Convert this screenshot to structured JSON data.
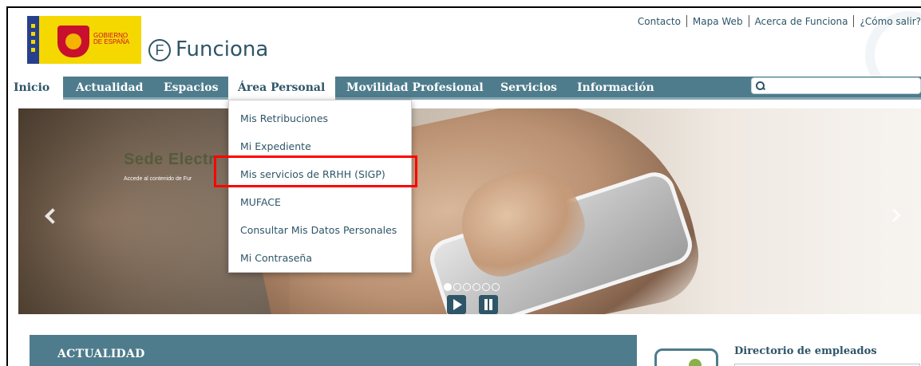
{
  "header": {
    "gov_text_line1": "GOBIERNO",
    "gov_text_line2": "DE ESPAÑA",
    "logo_letter": "F",
    "logo_word": "Funciona",
    "top_links": [
      "Contacto",
      "Mapa Web",
      "Acerca de Funciona",
      "¿Cómo salir?"
    ]
  },
  "nav": {
    "items": [
      "Inicio",
      "Actualidad",
      "Espacios",
      "Área Personal",
      "Movilidad Profesional",
      "Servicios",
      "Información"
    ],
    "active": "Inicio",
    "open_menu": "Área Personal",
    "search_placeholder": ""
  },
  "dropdown": {
    "items": [
      "Mis Retribuciones",
      "Mi Expediente",
      "Mis servicios de RRHH (SIGP)",
      "MUFACE",
      "Consultar Mis Datos Personales",
      "Mi Contraseña"
    ],
    "highlighted": "Mis servicios de RRHH (SIGP)"
  },
  "hero": {
    "title": "Sede Electr",
    "subtitle": "Accede al contenido de Fur",
    "dots_count": 6,
    "active_dot": 0
  },
  "sections": {
    "actualidad_title": "ACTUALIDAD",
    "directorio_title": "Directorio de empleados"
  },
  "colors": {
    "brand": "#2f5568",
    "nav_bg": "#4e7c8c",
    "highlight": "#ff0000"
  }
}
